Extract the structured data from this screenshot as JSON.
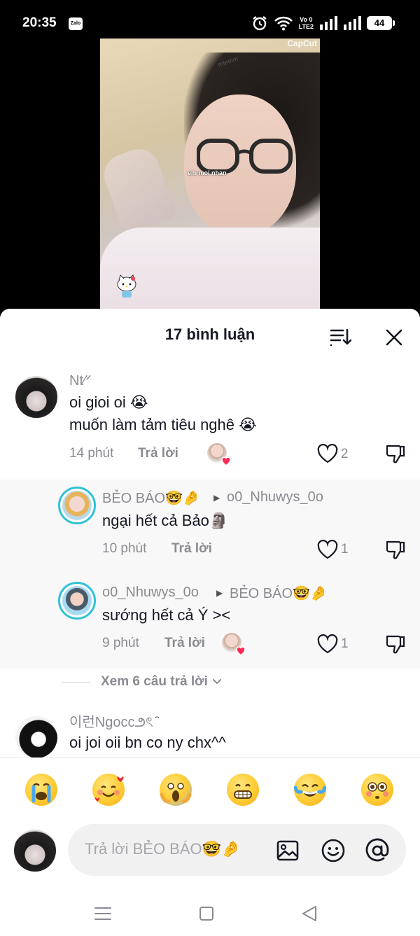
{
  "status_bar": {
    "time": "20:35",
    "notification_app": "Zalo",
    "network_label_top": "Vo 0",
    "network_label_bottom": "LTE2",
    "battery": "44"
  },
  "video": {
    "watermark": "CapCut",
    "caption_small": "mlemm",
    "overlay_text": "em moi nhan"
  },
  "sheet": {
    "title": "17 bình luận"
  },
  "comments": [
    {
      "username": "Nt⁄ᐟ",
      "lines": [
        "oi gioi oi 😭",
        "muốn làm tảm tiêu nghê 😭"
      ],
      "time": "14 phút",
      "reply_label": "Trả lời",
      "likes": "2"
    },
    {
      "username": "BẺO BÁO🤓🤌",
      "reply_to": "o0_Nhuwys_0o",
      "text": "ngại hết cả Bảo🗿",
      "time": "10 phút",
      "reply_label": "Trả lời",
      "likes": "1"
    },
    {
      "username": "o0_Nhuwys_0o",
      "reply_to": "BẺO BÁO🤓🤌",
      "text": "sướng hết cả Ý ><",
      "time": "9 phút",
      "reply_label": "Trả lời",
      "likes": "1"
    },
    {
      "username": "이런Ngocc౨ৎ ̑̈",
      "text": "oi joi oii bn co ny chx^^"
    }
  ],
  "view_more": "Xem 6 câu trả lời",
  "quick_emojis": [
    "loudly-crying",
    "smiling-face-with-hearts",
    "face-screaming-in-fear",
    "grinning-face",
    "face-with-tears-of-joy",
    "flushed-face"
  ],
  "input": {
    "placeholder": "Trả lời BẺO BÁO🤓🤌"
  },
  "colors": {
    "accent_heart": "#fe2c55",
    "ring": "#2fc2d6",
    "muted": "#8a8b91"
  }
}
